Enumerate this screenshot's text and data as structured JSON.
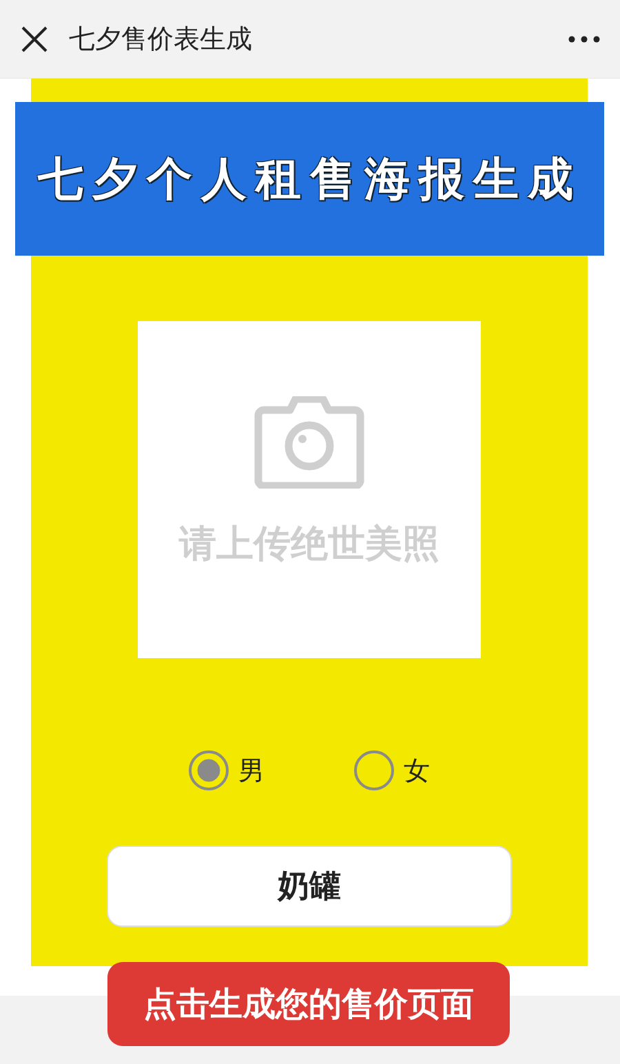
{
  "window": {
    "title": "七夕售价表生成"
  },
  "banner": {
    "title": "七夕个人租售海报生成"
  },
  "upload": {
    "hint": "请上传绝世美照"
  },
  "gender_options": [
    {
      "label": "男",
      "selected": true
    },
    {
      "label": "女",
      "selected": false
    }
  ],
  "name_field": {
    "value": "奶罐"
  },
  "submit_button": {
    "label": "点击生成您的售价页面"
  }
}
